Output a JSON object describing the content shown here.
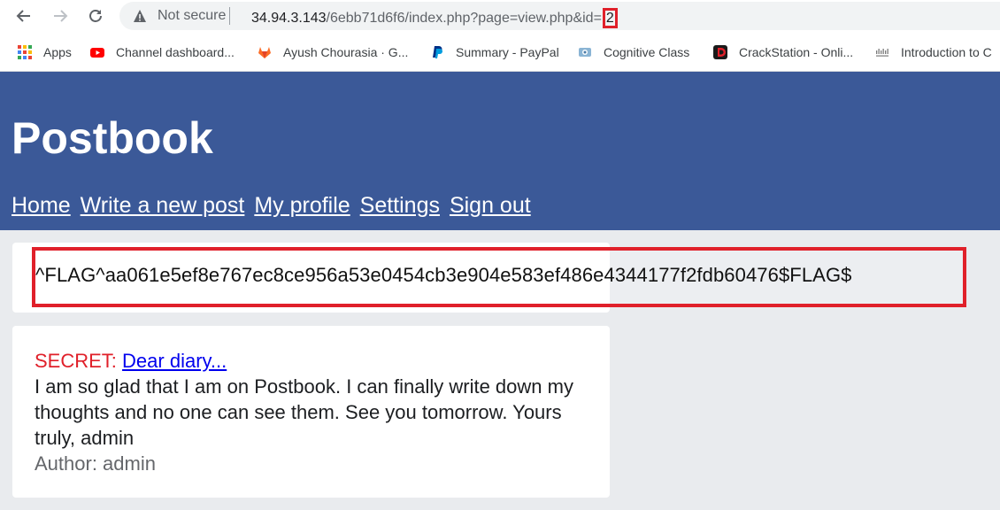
{
  "browser": {
    "security_label": "Not secure",
    "url_host": "34.94.3.143",
    "url_path": "/6ebb71d6f6/index.php?page=view.php&id=",
    "url_id": "2"
  },
  "bookmarks": [
    {
      "label": "Apps",
      "icon": "apps-grid-icon"
    },
    {
      "label": "Channel dashboard...",
      "icon": "youtube-icon"
    },
    {
      "label": "Ayush Chourasia · G...",
      "icon": "gitlab-icon"
    },
    {
      "label": "Summary - PayPal",
      "icon": "paypal-icon"
    },
    {
      "label": "Cognitive Class",
      "icon": "cognitive-class-icon"
    },
    {
      "label": "CrackStation - Onli...",
      "icon": "crackstation-icon"
    },
    {
      "label": "Introduction to C",
      "icon": "cisco-icon"
    }
  ],
  "site": {
    "title": "Postbook",
    "nav": [
      "Home",
      "Write a new post",
      "My profile",
      "Settings",
      "Sign out"
    ]
  },
  "posts": [
    {
      "content": "^FLAG^aa061e5ef8e767ec8ce956a53e0454cb3e904e583ef486e4344177f2fdb60476$FLAG$"
    },
    {
      "secret_label": "SECRET:",
      "title": "Dear diary...",
      "body": "I am so glad that I am on Postbook. I can finally write down my thoughts and no one can see them. See you tomorrow. Yours truly, admin",
      "author": "Author: admin"
    }
  ],
  "colors": {
    "header_bg": "#3b5998",
    "page_bg": "#e9ebee",
    "highlight": "#e0202a",
    "secret": "#e0202a",
    "link": "#0000ee"
  }
}
